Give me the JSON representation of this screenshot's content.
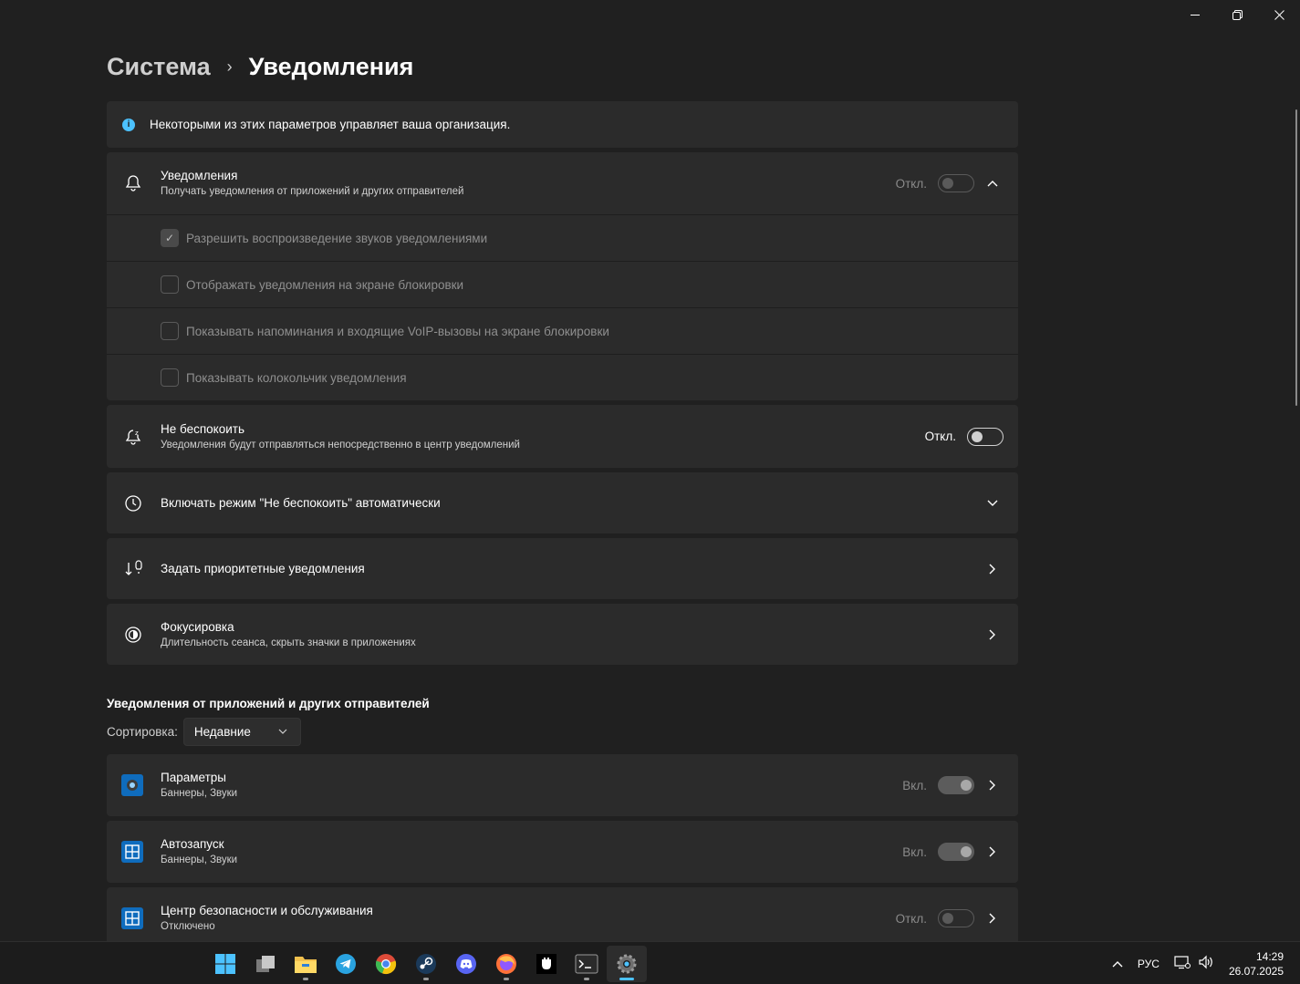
{
  "window": {
    "minimize_icon": "minimize-icon",
    "maximize_icon": "restore-icon",
    "close_icon": "close-icon"
  },
  "breadcrumb": {
    "parent": "Система",
    "separator": "›",
    "current": "Уведомления"
  },
  "info_banner": {
    "text": "Некоторыми из этих параметров управляет ваша организация.",
    "icon": "info-icon"
  },
  "notifications": {
    "title": "Уведомления",
    "subtitle": "Получать уведомления от приложений и других отправителей",
    "state": "Откл.",
    "toggle_on": false,
    "expanded": true,
    "options": [
      {
        "label": "Разрешить  воспроизведение звуков уведомлениями",
        "checked": true
      },
      {
        "label": "Отображать уведомления на экране блокировки",
        "checked": false
      },
      {
        "label": "Показывать напоминания и входящие VoIP-вызовы на экране блокировки",
        "checked": false
      },
      {
        "label": "Показывать колокольчик уведомления",
        "checked": false
      }
    ]
  },
  "dnd": {
    "title": "Не беспокоить",
    "subtitle": "Уведомления будут отправляться непосредственно в центр уведомлений",
    "state": "Откл.",
    "toggle_on": false
  },
  "auto_dnd": {
    "title": "Включать режим \"Не беспокоить\" автоматически"
  },
  "priority": {
    "title": "Задать приоритетные уведомления"
  },
  "focus": {
    "title": "Фокусировка",
    "subtitle": "Длительность сеанса, скрыть значки в приложениях"
  },
  "apps_section": {
    "title": "Уведомления от приложений и других отправителей",
    "sort_label": "Сортировка:",
    "sort_value": "Недавние",
    "apps": [
      {
        "name": "Параметры",
        "detail": "Баннеры, Звуки",
        "state": "Вкл.",
        "toggle_on": true
      },
      {
        "name": "Автозапуск",
        "detail": "Баннеры, Звуки",
        "state": "Вкл.",
        "toggle_on": true
      },
      {
        "name": "Центр безопасности и обслуживания",
        "detail": "Отключено",
        "state": "Откл.",
        "toggle_on": false
      }
    ]
  },
  "taskbar": {
    "apps": [
      "start",
      "task-view",
      "file-explorer",
      "telegram",
      "chrome",
      "steam",
      "discord",
      "firefox",
      "app-black",
      "terminal",
      "settings"
    ],
    "language": "РУС",
    "time": "14:29",
    "date": "26.07.2025"
  },
  "colors": {
    "background": "#202020",
    "card": "#2b2b2b",
    "accent": "#4cc2ff",
    "taskbar": "#1c1c1c"
  }
}
